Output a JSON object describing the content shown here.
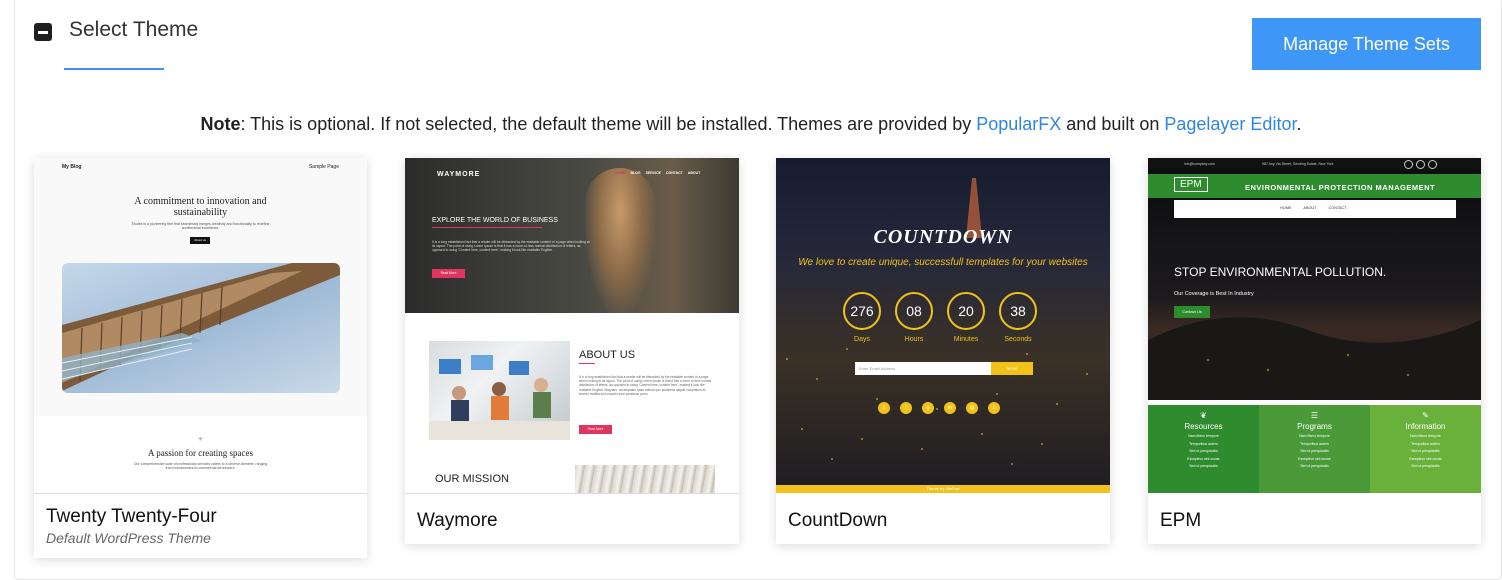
{
  "section": {
    "title": "Select Theme",
    "manage_button": "Manage Theme Sets"
  },
  "note": {
    "label": "Note",
    "text_before": ": This is optional. If not selected, the default theme will be installed. Themes are provided by ",
    "link1": "PopularFX",
    "text_middle": " and built on ",
    "link2": "Pagelayer Editor",
    "text_end": "."
  },
  "themes": [
    {
      "name": "Twenty Twenty-Four",
      "subtitle": "Default WordPress Theme",
      "preview": {
        "site_title": "My Blog",
        "nav": "Sample Page",
        "headline": "A commitment to innovation and sustainability",
        "body": "Études is a pioneering firm that seamlessly merges creativity and functionality to redefine architectural excellence.",
        "button": "About us",
        "headline2": "A passion for creating spaces",
        "body2": "Our comprehensive suite of professional services caters to a diverse clientele, ranging from homeowners to commercial developers."
      }
    },
    {
      "name": "Waymore",
      "preview": {
        "logo": "WAYMORE",
        "nav": [
          "HOME",
          "BLOG",
          "SERVICE",
          "CONTACT",
          "ABOUT"
        ],
        "hero": "EXPLORE THE WORLD OF BUSINESS",
        "hero_body": "It is a long established fact that a reader will be distracted by the readable content of a page when looking at its layout. The point of using Lorem Ipsum is that it has a more-or-less normal distribution of letters, as opposed to using 'Content here, content here', making it look like readable English.",
        "hero_button": "Read More",
        "about": "ABOUT US",
        "about_body": "It is a long established fact that a reader will be distracted by the readable content of a page when looking at its layout. The point of using Lorem Ipsum is that it has a more-or-less normal distribution of letters, as opposed to using 'Content here, content here', making it look like readable English. Magnam, consequatur quas ratione quo possimus aliquid voluptatum at tenetur mollitia sint corporis eum possimus porro.",
        "about_button": "Read More",
        "mission": "OUR MISSION"
      }
    },
    {
      "name": "CountDown",
      "preview": {
        "title": "COUNTDOWN",
        "tagline": "We love to create unique, successfull templates for your websites",
        "timer": [
          {
            "value": "276",
            "label": "Days"
          },
          {
            "value": "08",
            "label": "Hours"
          },
          {
            "value": "20",
            "label": "Minutes"
          },
          {
            "value": "38",
            "label": "Seconds"
          }
        ],
        "email_placeholder": "Enter Email Address",
        "send": "SEND",
        "social": [
          "f",
          "t",
          "g",
          "in",
          "ig",
          "t"
        ],
        "footer": "Theme by SitePad"
      }
    },
    {
      "name": "EPM",
      "preview": {
        "topbar_email": "info@company.com",
        "topbar_address": "987 Any Via Street, Sending Estate, New York",
        "logo": "EPM",
        "org": "ENVIRONMENTAL PROTECTION MANAGEMENT",
        "nav": [
          "HOME",
          "ABOUT",
          "CONTACT"
        ],
        "hero": "STOP ENVIRONMENTAL POLLUTION.",
        "hero_sub": "Our Coverage is Best In Industry",
        "hero_button": "Contact Us",
        "columns": [
          {
            "title": "Resources",
            "items": [
              "Nam libero tempore",
              "Temporibus autem",
              "Sed ut perspiciatis",
              "Excepteur sint occae",
              "Sed ut perspiciatis"
            ]
          },
          {
            "title": "Programs",
            "items": [
              "Nam libero tempore",
              "Temporibus autem",
              "Sed ut perspiciatis",
              "Excepteur sint occae",
              "Sed ut perspiciatis"
            ]
          },
          {
            "title": "Information",
            "items": [
              "Nam libero tempore",
              "Temporibus autem",
              "Sed ut perspiciatis",
              "Excepteur sint occae",
              "Sed ut perspiciatis"
            ]
          }
        ]
      }
    }
  ],
  "colors": {
    "accent": "#3e97f7",
    "link": "#2f86e0",
    "waymore_button": "#e0355e",
    "countdown_gold": "#f2c21b",
    "epm_green": "#2e8b2e"
  }
}
